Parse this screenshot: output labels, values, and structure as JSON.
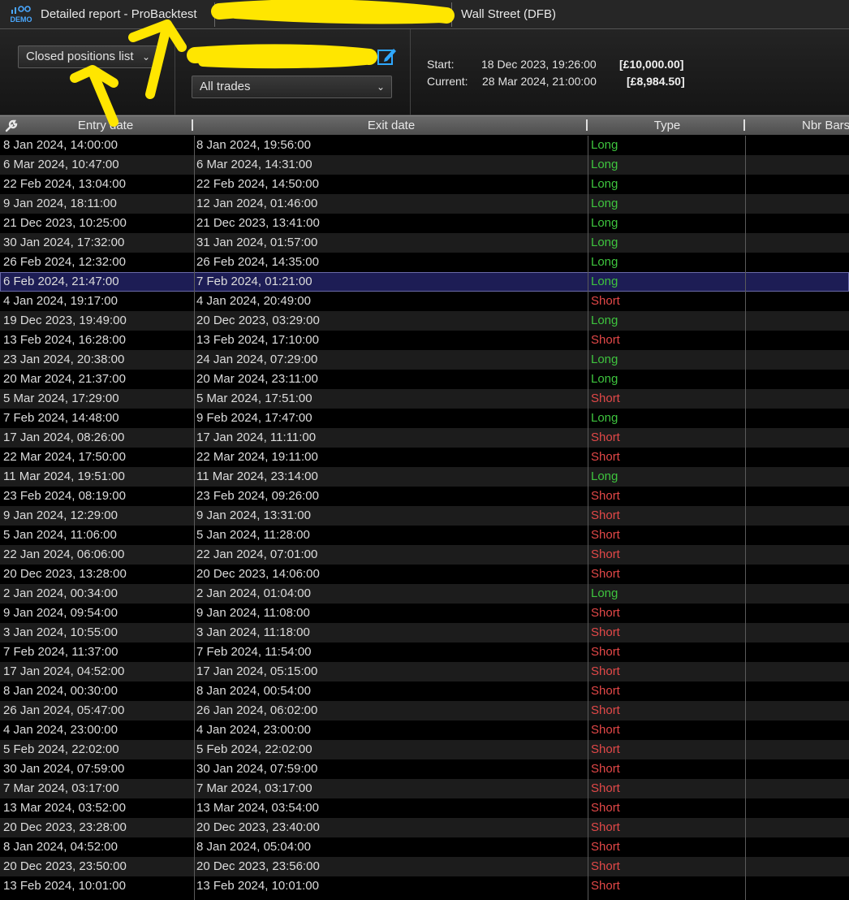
{
  "titlebar": {
    "demo_badge": "DEMO",
    "title": "Detailed report - ProBacktest",
    "instrument": "Wall Street (DFB)"
  },
  "controls": {
    "view_select": "Closed positions list",
    "filter_select": "All trades",
    "start_label": "Start:",
    "start_date": "18 Dec 2023, 19:26:00",
    "start_value": "[£10,000.00]",
    "current_label": "Current:",
    "current_date": "28 Mar 2024, 21:00:00",
    "current_value": "[£8,984.50]"
  },
  "table": {
    "columns": [
      "Entry date",
      "Exit date",
      "Type",
      "Nbr Bars"
    ],
    "rows": [
      {
        "entry": "8 Jan 2024, 14:00:00",
        "exit": "8 Jan 2024, 19:56:00",
        "type": "Long"
      },
      {
        "entry": "6 Mar 2024, 10:47:00",
        "exit": "6 Mar 2024, 14:31:00",
        "type": "Long"
      },
      {
        "entry": "22 Feb 2024, 13:04:00",
        "exit": "22 Feb 2024, 14:50:00",
        "type": "Long"
      },
      {
        "entry": "9 Jan 2024, 18:11:00",
        "exit": "12 Jan 2024, 01:46:00",
        "type": "Long"
      },
      {
        "entry": "21 Dec 2023, 10:25:00",
        "exit": "21 Dec 2023, 13:41:00",
        "type": "Long"
      },
      {
        "entry": "30 Jan 2024, 17:32:00",
        "exit": "31 Jan 2024, 01:57:00",
        "type": "Long"
      },
      {
        "entry": "26 Feb 2024, 12:32:00",
        "exit": "26 Feb 2024, 14:35:00",
        "type": "Long"
      },
      {
        "entry": "6 Feb 2024, 21:47:00",
        "exit": "7 Feb 2024, 01:21:00",
        "type": "Long",
        "selected": true
      },
      {
        "entry": "4 Jan 2024, 19:17:00",
        "exit": "4 Jan 2024, 20:49:00",
        "type": "Short"
      },
      {
        "entry": "19 Dec 2023, 19:49:00",
        "exit": "20 Dec 2023, 03:29:00",
        "type": "Long"
      },
      {
        "entry": "13 Feb 2024, 16:28:00",
        "exit": "13 Feb 2024, 17:10:00",
        "type": "Short"
      },
      {
        "entry": "23 Jan 2024, 20:38:00",
        "exit": "24 Jan 2024, 07:29:00",
        "type": "Long"
      },
      {
        "entry": "20 Mar 2024, 21:37:00",
        "exit": "20 Mar 2024, 23:11:00",
        "type": "Long"
      },
      {
        "entry": "5 Mar 2024, 17:29:00",
        "exit": "5 Mar 2024, 17:51:00",
        "type": "Short"
      },
      {
        "entry": "7 Feb 2024, 14:48:00",
        "exit": "9 Feb 2024, 17:47:00",
        "type": "Long"
      },
      {
        "entry": "17 Jan 2024, 08:26:00",
        "exit": "17 Jan 2024, 11:11:00",
        "type": "Short"
      },
      {
        "entry": "22 Mar 2024, 17:50:00",
        "exit": "22 Mar 2024, 19:11:00",
        "type": "Short"
      },
      {
        "entry": "11 Mar 2024, 19:51:00",
        "exit": "11 Mar 2024, 23:14:00",
        "type": "Long"
      },
      {
        "entry": "23 Feb 2024, 08:19:00",
        "exit": "23 Feb 2024, 09:26:00",
        "type": "Short"
      },
      {
        "entry": "9 Jan 2024, 12:29:00",
        "exit": "9 Jan 2024, 13:31:00",
        "type": "Short"
      },
      {
        "entry": "5 Jan 2024, 11:06:00",
        "exit": "5 Jan 2024, 11:28:00",
        "type": "Short"
      },
      {
        "entry": "22 Jan 2024, 06:06:00",
        "exit": "22 Jan 2024, 07:01:00",
        "type": "Short"
      },
      {
        "entry": "20 Dec 2023, 13:28:00",
        "exit": "20 Dec 2023, 14:06:00",
        "type": "Short"
      },
      {
        "entry": "2 Jan 2024, 00:34:00",
        "exit": "2 Jan 2024, 01:04:00",
        "type": "Long"
      },
      {
        "entry": "9 Jan 2024, 09:54:00",
        "exit": "9 Jan 2024, 11:08:00",
        "type": "Short"
      },
      {
        "entry": "3 Jan 2024, 10:55:00",
        "exit": "3 Jan 2024, 11:18:00",
        "type": "Short"
      },
      {
        "entry": "7 Feb 2024, 11:37:00",
        "exit": "7 Feb 2024, 11:54:00",
        "type": "Short"
      },
      {
        "entry": "17 Jan 2024, 04:52:00",
        "exit": "17 Jan 2024, 05:15:00",
        "type": "Short"
      },
      {
        "entry": "8 Jan 2024, 00:30:00",
        "exit": "8 Jan 2024, 00:54:00",
        "type": "Short"
      },
      {
        "entry": "26 Jan 2024, 05:47:00",
        "exit": "26 Jan 2024, 06:02:00",
        "type": "Short"
      },
      {
        "entry": "4 Jan 2024, 23:00:00",
        "exit": "4 Jan 2024, 23:00:00",
        "type": "Short"
      },
      {
        "entry": "5 Feb 2024, 22:02:00",
        "exit": "5 Feb 2024, 22:02:00",
        "type": "Short"
      },
      {
        "entry": "30 Jan 2024, 07:59:00",
        "exit": "30 Jan 2024, 07:59:00",
        "type": "Short"
      },
      {
        "entry": "7 Mar 2024, 03:17:00",
        "exit": "7 Mar 2024, 03:17:00",
        "type": "Short"
      },
      {
        "entry": "13 Mar 2024, 03:52:00",
        "exit": "13 Mar 2024, 03:54:00",
        "type": "Short"
      },
      {
        "entry": "20 Dec 2023, 23:28:00",
        "exit": "20 Dec 2023, 23:40:00",
        "type": "Short"
      },
      {
        "entry": "8 Jan 2024, 04:52:00",
        "exit": "8 Jan 2024, 05:04:00",
        "type": "Short"
      },
      {
        "entry": "20 Dec 2023, 23:50:00",
        "exit": "20 Dec 2023, 23:56:00",
        "type": "Short"
      },
      {
        "entry": "13 Feb 2024, 10:01:00",
        "exit": "13 Feb 2024, 10:01:00",
        "type": "Short"
      }
    ]
  },
  "colors": {
    "long": "#3ec43e",
    "short": "#e24848",
    "highlight_marker": "#ffe600",
    "selected_row": "#1d1d55"
  }
}
